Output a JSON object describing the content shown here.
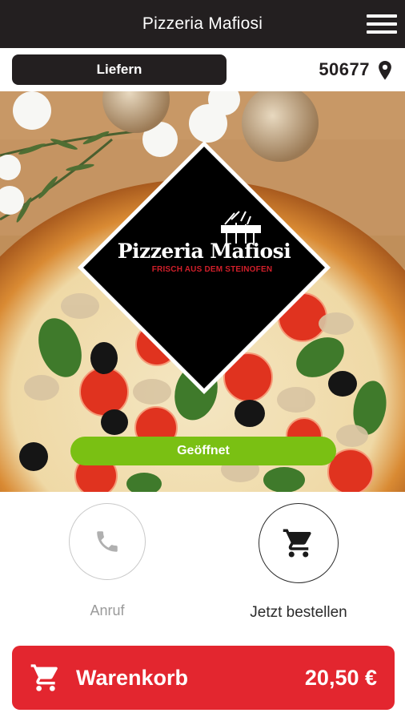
{
  "header": {
    "title": "Pizzeria Mafiosi",
    "menu_icon": "hamburger-menu-icon"
  },
  "delivery": {
    "mode_label": "Liefern",
    "zip_code": "50677",
    "location_icon": "location-pin-icon"
  },
  "hero": {
    "logo_title": "Pizzeria Mafiosi",
    "logo_subtitle": "FRISCH AUS DEM STEINOFEN",
    "status_label": "Geöffnet",
    "status_color": "#7ac013"
  },
  "actions": {
    "call_label": "Anruf",
    "call_icon": "phone-icon",
    "order_label": "Jetzt bestellen",
    "order_icon": "shopping-cart-icon"
  },
  "cart": {
    "label": "Warenkorb",
    "total": "20,50 €",
    "icon": "shopping-cart-icon",
    "color": "#e3262f"
  },
  "colors": {
    "header_bg": "#231f20",
    "accent_red": "#e3262f",
    "open_green": "#7ac013"
  }
}
